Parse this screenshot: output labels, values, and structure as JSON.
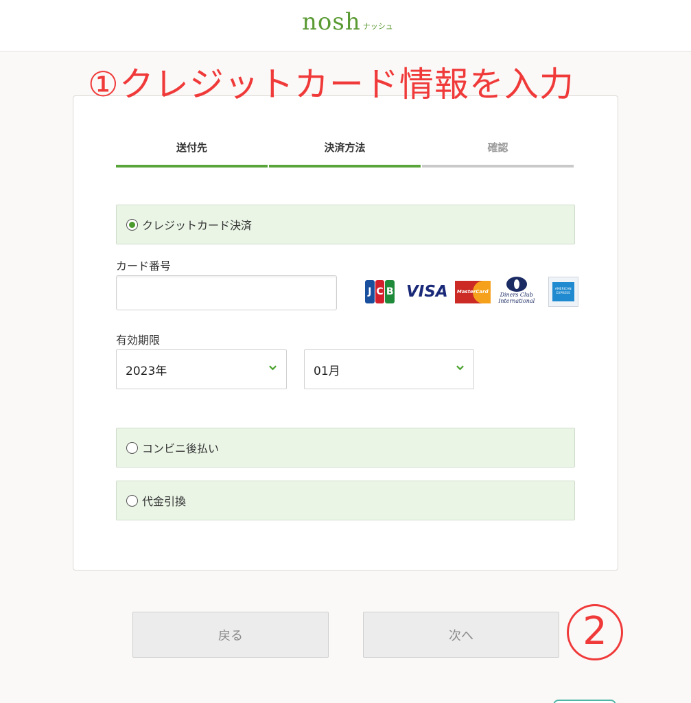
{
  "header": {
    "logo_text": "nosh",
    "logo_kana": "ナッシュ"
  },
  "annotations": {
    "step1": "①クレジットカード情報を入力",
    "step2": "2"
  },
  "steps": [
    {
      "label": "送付先",
      "state": "done"
    },
    {
      "label": "決済方法",
      "state": "done"
    },
    {
      "label": "確認",
      "state": "todo"
    }
  ],
  "payment": {
    "credit_option": "クレジットカード決済",
    "card_number_label": "カード番号",
    "card_number_value": "",
    "expiry_label": "有効期限",
    "year_value": "2023年",
    "month_value": "01月",
    "convenience_option": "コンビニ後払い",
    "cod_option": "代金引換",
    "selected": "credit",
    "card_brands": {
      "jcb": "JCB",
      "visa": "VISA",
      "mastercard": "MasterCard",
      "diners_line1": "Diners Club",
      "diners_line2": "International",
      "amex_line1": "AMERICAN",
      "amex_line2": "EXPRESS"
    }
  },
  "buttons": {
    "back": "戻る",
    "next": "次へ"
  },
  "colors": {
    "brand_green": "#5a9a33",
    "annotation_red": "#f03a3a",
    "option_bg": "#eaf5e6"
  }
}
